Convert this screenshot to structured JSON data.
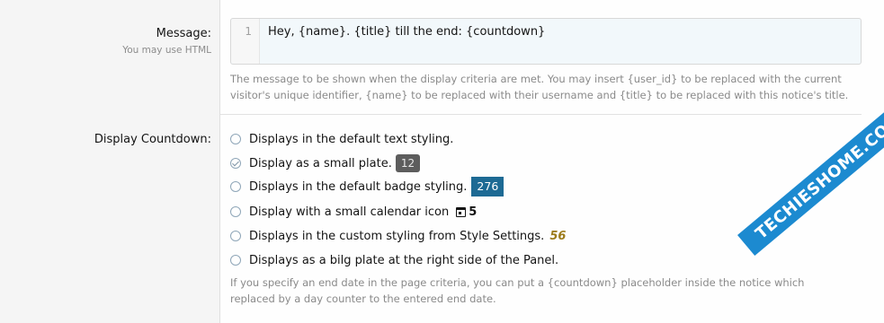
{
  "message": {
    "label": "Message:",
    "sublabel": "You may use HTML",
    "line_number": "1",
    "code": "Hey, {name}. {title} till the end: {countdown}",
    "help_line1": "The message to be shown when the display criteria are met. You may insert {user_id} to be replaced with the current",
    "help_line2": "visitor's unique identifier, {name} to be replaced with their username and {title} to be replaced with this notice's title."
  },
  "countdown": {
    "label": "Display Countdown:",
    "options": [
      {
        "label": "Displays in the default text styling.",
        "checked": false
      },
      {
        "label": "Display as a small plate.",
        "sample": "12",
        "checked": true
      },
      {
        "label": "Displays in the default badge styling.",
        "sample": "276",
        "checked": false
      },
      {
        "label": "Display with a small calendar icon",
        "sample": "5",
        "checked": false
      },
      {
        "label": "Displays in the custom styling from Style Settings.",
        "sample": "56",
        "checked": false
      },
      {
        "label": "Displays as a bilg plate at the right side of the Panel.",
        "checked": false
      }
    ],
    "help_line1": "If you specify an end date in the page criteria, you can put a {countdown} placeholder inside the notice which",
    "help_line2": "replaced by a day counter to the entered end date."
  },
  "watermark": {
    "text": "TECHIESHOME.COM",
    "color": "#1c8ad0"
  },
  "colors": {
    "badge": "#1d6a94",
    "small_plate": "#5d5d5d",
    "custom": "#9d7c1c"
  }
}
